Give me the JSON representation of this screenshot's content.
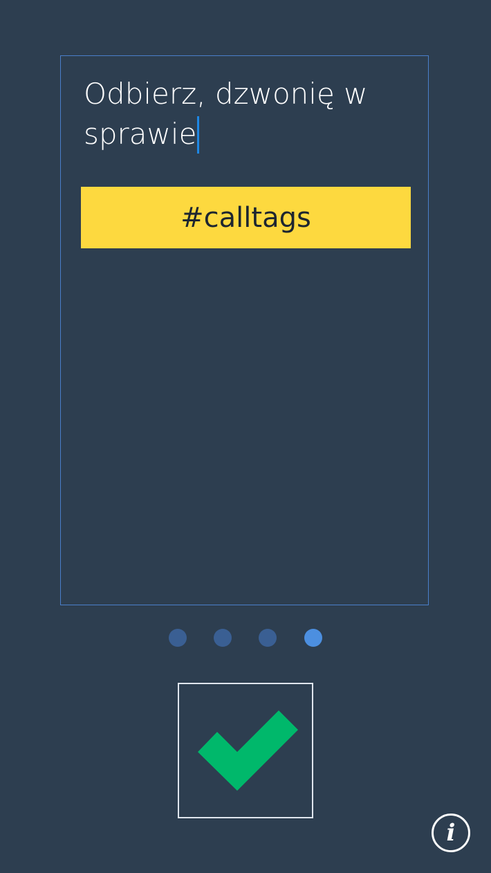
{
  "card": {
    "message_text": "Odbierz, dzwonię w sprawie",
    "tag_label": "#calltags"
  },
  "pager": {
    "page_count": 4,
    "current_page": 4
  },
  "actions": {
    "confirm_icon": "checkmark-icon",
    "info_label": "i",
    "info_icon": "info-icon"
  },
  "colors": {
    "background": "#2d3e50",
    "card_border": "#4a7fcb",
    "tag_background": "#fdd93f",
    "caret": "#1e88e5",
    "dot_inactive": "#3a5f93",
    "dot_active": "#4c8fe0",
    "checkmark": "#00b86b"
  }
}
